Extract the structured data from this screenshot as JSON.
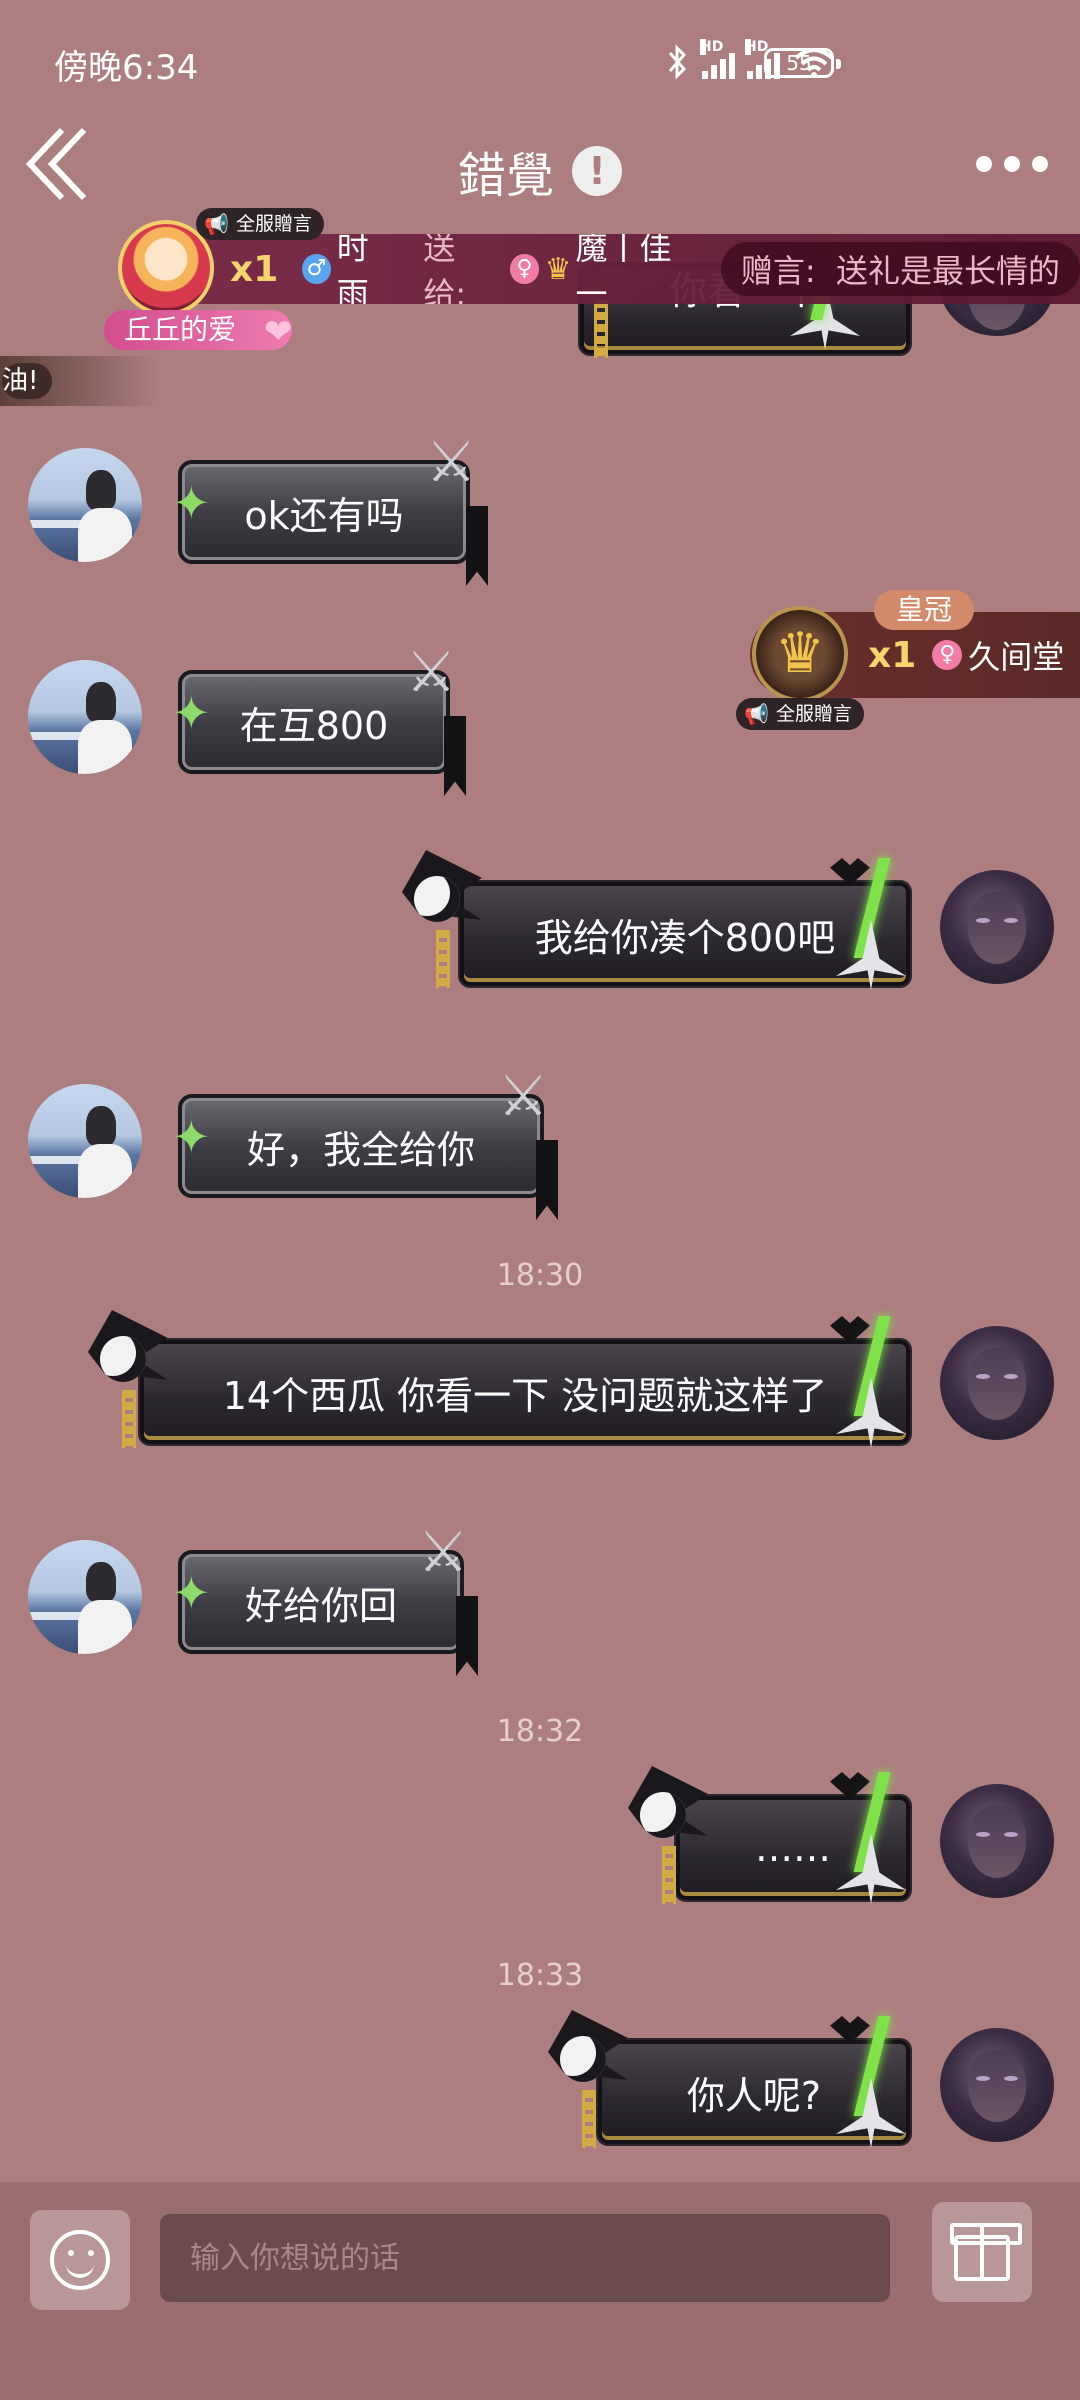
{
  "status_bar": {
    "time": "傍晚6:34",
    "battery": "55",
    "hd1": "HD",
    "hd2": "HD"
  },
  "header": {
    "title": "錯覺",
    "alert_glyph": "!"
  },
  "gift_banner": {
    "tag": "全服贈言",
    "count": "x1",
    "sender": "时雨",
    "to_label": "送给:",
    "receiver": "魔丨佳一",
    "message_label": "赠言:",
    "message": "送礼是最长情的",
    "sender_pill": "丘丘的爱",
    "left_fragment": "油!"
  },
  "gift_banner_2": {
    "gift_name": "皇冠",
    "count": "x1",
    "receiver": "久间堂",
    "tag": "全服贈言"
  },
  "messages": [
    {
      "side": "right",
      "text": "你看一下"
    },
    {
      "side": "left",
      "text": "ok还有吗"
    },
    {
      "side": "left",
      "text": "在互800"
    },
    {
      "side": "right",
      "text": "我给你凑个800吧"
    },
    {
      "side": "left",
      "text": "好，我全给你"
    },
    {
      "side": "right",
      "text": "14个西瓜 你看一下 没问题就这样了"
    },
    {
      "side": "left",
      "text": "好给你回"
    },
    {
      "side": "right",
      "text": "……"
    },
    {
      "side": "right",
      "text": "你人呢?"
    }
  ],
  "timestamps": [
    "18:30",
    "18:32",
    "18:33"
  ],
  "input_bar": {
    "placeholder": "输入你想说的话"
  },
  "colors": {
    "background": "#ad7e80",
    "accent_green": "#7fe24a",
    "gold": "#d2ab45"
  }
}
